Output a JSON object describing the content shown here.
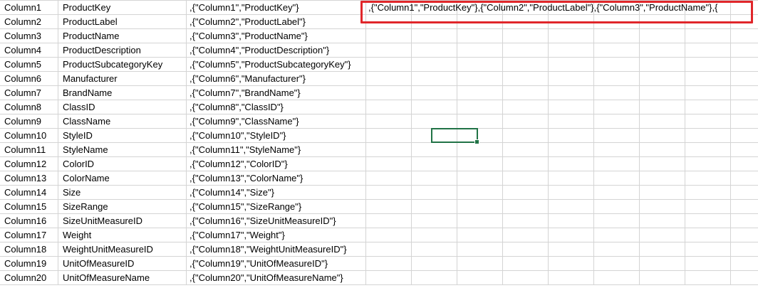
{
  "rows": [
    {
      "a": "Column1",
      "b": "ProductKey",
      "c": ",{\"Column1\",\"ProductKey\"}"
    },
    {
      "a": "Column2",
      "b": "ProductLabel",
      "c": ",{\"Column2\",\"ProductLabel\"}"
    },
    {
      "a": "Column3",
      "b": "ProductName",
      "c": ",{\"Column3\",\"ProductName\"}"
    },
    {
      "a": "Column4",
      "b": "ProductDescription",
      "c": ",{\"Column4\",\"ProductDescription\"}"
    },
    {
      "a": "Column5",
      "b": "ProductSubcategoryKey",
      "c": ",{\"Column5\",\"ProductSubcategoryKey\"}"
    },
    {
      "a": "Column6",
      "b": "Manufacturer",
      "c": ",{\"Column6\",\"Manufacturer\"}"
    },
    {
      "a": "Column7",
      "b": "BrandName",
      "c": ",{\"Column7\",\"BrandName\"}"
    },
    {
      "a": "Column8",
      "b": "ClassID",
      "c": ",{\"Column8\",\"ClassID\"}"
    },
    {
      "a": "Column9",
      "b": "ClassName",
      "c": ",{\"Column9\",\"ClassName\"}"
    },
    {
      "a": "Column10",
      "b": "StyleID",
      "c": ",{\"Column10\",\"StyleID\"}"
    },
    {
      "a": "Column11",
      "b": "StyleName",
      "c": ",{\"Column11\",\"StyleName\"}"
    },
    {
      "a": "Column12",
      "b": "ColorID",
      "c": ",{\"Column12\",\"ColorID\"}"
    },
    {
      "a": "Column13",
      "b": "ColorName",
      "c": ",{\"Column13\",\"ColorName\"}"
    },
    {
      "a": "Column14",
      "b": "Size",
      "c": ",{\"Column14\",\"Size\"}"
    },
    {
      "a": "Column15",
      "b": "SizeRange",
      "c": ",{\"Column15\",\"SizeRange\"}"
    },
    {
      "a": "Column16",
      "b": "SizeUnitMeasureID",
      "c": ",{\"Column16\",\"SizeUnitMeasureID\"}"
    },
    {
      "a": "Column17",
      "b": "Weight",
      "c": ",{\"Column17\",\"Weight\"}"
    },
    {
      "a": "Column18",
      "b": "WeightUnitMeasureID",
      "c": ",{\"Column18\",\"WeightUnitMeasureID\"}"
    },
    {
      "a": "Column19",
      "b": "UnitOfMeasureID",
      "c": ",{\"Column19\",\"UnitOfMeasureID\"}"
    },
    {
      "a": "Column20",
      "b": "UnitOfMeasureName",
      "c": ",{\"Column20\",\"UnitOfMeasureName\"}"
    }
  ],
  "concatenated_cell": ",{\"Column1\",\"ProductKey\"},{\"Column2\",\"ProductLabel\"},{\"Column3\",\"ProductName\"},{",
  "colors": {
    "gridline": "#d4d4d4",
    "highlight_border": "#e0262a",
    "selection_border": "#217346"
  }
}
